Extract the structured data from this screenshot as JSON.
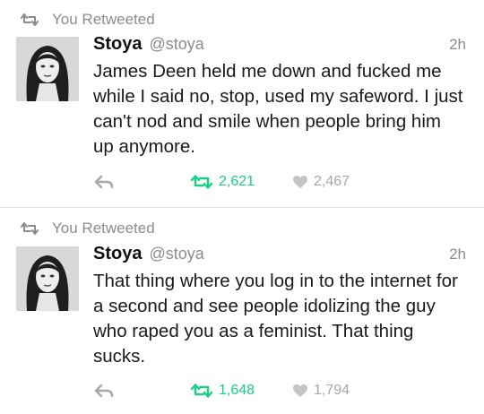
{
  "tweets": [
    {
      "retweet_label": "You Retweeted",
      "name": "Stoya",
      "handle": "@stoya",
      "time": "2h",
      "text": "James Deen held me down and fucked me while I said no, stop, used my safeword. I just can't nod and smile when people bring him up anymore.",
      "retweets": "2,621",
      "likes": "2,467"
    },
    {
      "retweet_label": "You Retweeted",
      "name": "Stoya",
      "handle": "@stoya",
      "time": "2h",
      "text": "That thing where you log in to the internet for a second and see people idolizing the guy who raped you as a feminist. That thing sucks.",
      "retweets": "1,648",
      "likes": "1,794"
    }
  ],
  "icons": {
    "retweet": "retweet-icon",
    "reply": "reply-icon",
    "like": "heart-icon"
  },
  "colors": {
    "retweet_active": "#19cf86",
    "muted": "#8c8c8c",
    "like_muted": "#a8a8a8"
  }
}
